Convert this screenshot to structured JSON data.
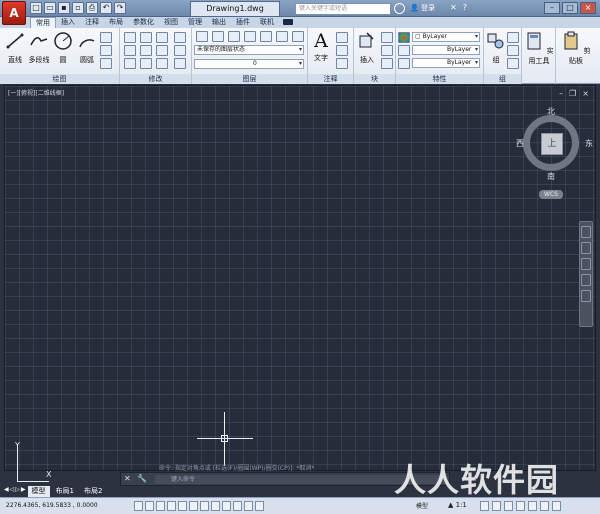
{
  "titlebar": {
    "app_letter": "A",
    "document": "Drawing1.dwg",
    "search_placeholder": "键入关键字或短语",
    "login": "登录"
  },
  "ribbon_tabs": [
    "常用",
    "插入",
    "注释",
    "布局",
    "参数化",
    "视图",
    "管理",
    "输出",
    "插件",
    "联机"
  ],
  "active_tab": "常用",
  "draw_panel": {
    "title": "绘图",
    "tools": [
      "直线",
      "多段线",
      "圆",
      "圆弧"
    ]
  },
  "modify_panel": {
    "title": "修改"
  },
  "layers_panel": {
    "title": "图层",
    "layer_state": "未保存的图层状态",
    "current_layer": "0"
  },
  "annotation_panel": {
    "title": "注释",
    "text_tool": "文字"
  },
  "block_panel": {
    "title": "块",
    "insert_tool": "插入"
  },
  "properties_panel": {
    "title": "特性",
    "color": "ByLayer",
    "linetype": "ByLayer",
    "lineweight": "ByLayer"
  },
  "group_panel": {
    "title": "组",
    "group_tool": "组"
  },
  "utilities_panel": {
    "title": "",
    "tool": "实用工具"
  },
  "clipboard_panel": {
    "title": "",
    "tool": "剪贴板"
  },
  "viewport": {
    "label": "[一][俯视][二维线框]"
  },
  "viewcube": {
    "face": "上",
    "north": "北",
    "south": "南",
    "east": "东",
    "west": "西",
    "wcs": "WCS"
  },
  "ucs": {
    "x": "X",
    "y": "Y"
  },
  "command": {
    "history": "命令: 指定对角点或 [栏选(F)/圈围(WP)/圈交(CP)]: *取消*",
    "placeholder": "键入命令"
  },
  "layout_tabs": [
    "模型",
    "布局1",
    "布局2"
  ],
  "active_layout": "模型",
  "status": {
    "coordinates": "2276.4365, 619.5833 , 0.0000",
    "model": "模型",
    "scale": "1:1"
  },
  "watermark": "人人软件园"
}
